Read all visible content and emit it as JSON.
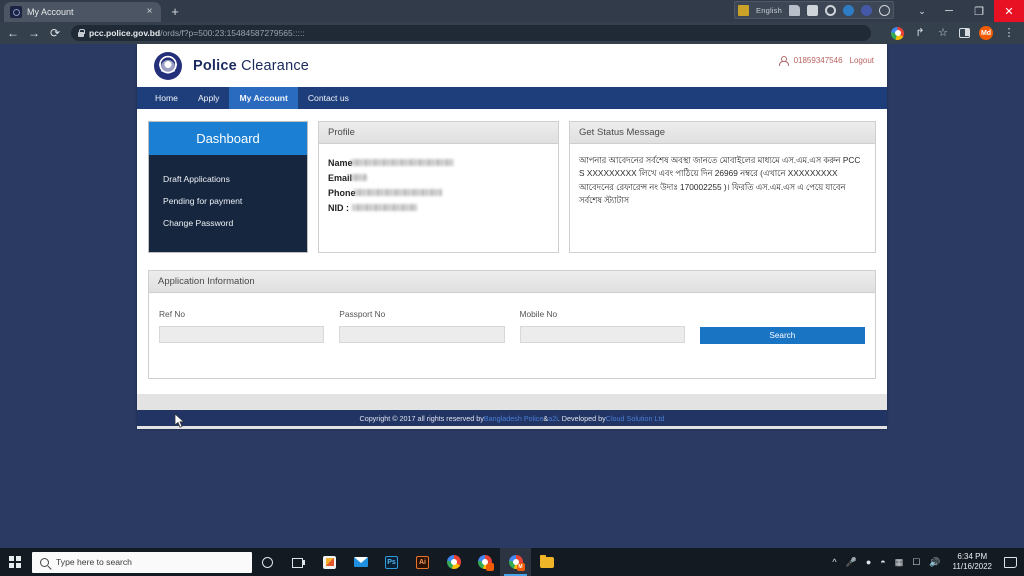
{
  "browser": {
    "tab": {
      "title": "My Account",
      "close_label": "×",
      "favicon": "police-emblem-favicon"
    },
    "new_tab_label": "+",
    "back_label": "←",
    "forward_label": "→",
    "reload_label": "⟳",
    "url_domain": "pcc.police.gov.bd",
    "url_path": "/ords/f?p=500:23:15484587279565:::::",
    "profile_initials": "Md",
    "menu_label": "⋮",
    "share_label": "↱",
    "bookmark_label": "☆",
    "window_controls": {
      "chevron": "⌄",
      "minimize": "─",
      "maximize": "❐",
      "close": "✕"
    }
  },
  "langbar": {
    "language": "English",
    "icons": [
      "keyboard-icon",
      "ink-pen-icon",
      "tool-icon",
      "ring-icon",
      "internet-explorer-icon",
      "help-icon",
      "info-icon"
    ]
  },
  "site": {
    "brand_bold": "Police",
    "brand_light": "Clearance",
    "phone": "01859347546",
    "logout": "Logout",
    "nav": [
      {
        "label": "Home",
        "active": false
      },
      {
        "label": "Apply",
        "active": false
      },
      {
        "label": "My Account",
        "active": true
      },
      {
        "label": "Contact us",
        "active": false
      }
    ],
    "dashboard": {
      "title": "Dashboard",
      "items": [
        "Draft Applications",
        "Pending for payment",
        "Change Password"
      ]
    },
    "profile": {
      "title": "Profile",
      "rows": [
        {
          "label": "Name",
          "value": "",
          "redacted": true,
          "redact_width": 103
        },
        {
          "label": "Email",
          "value": "",
          "redacted": true,
          "redact_width": 17
        },
        {
          "label": "Phone",
          "value": "",
          "redacted": true,
          "redact_width": 88
        },
        {
          "label": "NID :",
          "value": "",
          "redacted": true,
          "redact_width": 65
        }
      ]
    },
    "status": {
      "title": "Get Status Message",
      "message": "আপনার আবেদনের সর্বশেষ অবস্থা জানতে মোবাইলের মাধ্যমে এস.এম.এস করুন PCC S XXXXXXXXX লিখে এবং পাঠিয়ে দিন 26969 নম্বরে (এখানে XXXXXXXXX আবেদনের রেফারেন্স নং উদাঃ 170002255 )। ফিরতি এস.এম.এস এ পেয়ে যাবেন সর্বশেষ স্ট্যাটাস"
    },
    "application_information": {
      "title": "Application Information",
      "fields": [
        {
          "label": "Ref No",
          "value": "",
          "placeholder": ""
        },
        {
          "label": "Passport No",
          "value": "",
          "placeholder": ""
        },
        {
          "label": "Mobile No",
          "value": "",
          "placeholder": ""
        }
      ],
      "search_label": "Search"
    },
    "footer": {
      "prefix": "Copyright © 2017 all rights reserved by ",
      "link1": "Bangladesh Police",
      "mid": " & ",
      "link2": "a2i",
      "suffix": ". Developed by ",
      "link3": "Cloud Solution Ltd"
    }
  },
  "taskbar": {
    "search_placeholder": "Type here to search",
    "apps": [
      "cortana-icon",
      "task-view-icon",
      "microsoft-store-icon",
      "mail-icon",
      "photoshop-icon",
      "illustrator-icon",
      "chrome-icon",
      "chrome-window-icon",
      "chrome-active-icon",
      "file-explorer-icon"
    ],
    "tray": [
      "show-hidden-icons",
      "microphone-icon",
      "notification-red-icon",
      "wifi-icon",
      "keyboard-tray-icon",
      "display-icon",
      "volume-icon"
    ],
    "clock_time": "6:34 PM",
    "clock_date": "11/16/2022",
    "notification_center": "notification-center-icon"
  },
  "colors": {
    "nav_bar": "#1e3e7b",
    "nav_active": "#2a6bbf",
    "dashboard_header": "#1b7fd4",
    "dashboard_body": "#17263f",
    "search_button": "#1a74c4",
    "footer_bar": "#223463",
    "accent_link": "#4a7fd4",
    "desktop": "#2b3a63"
  }
}
